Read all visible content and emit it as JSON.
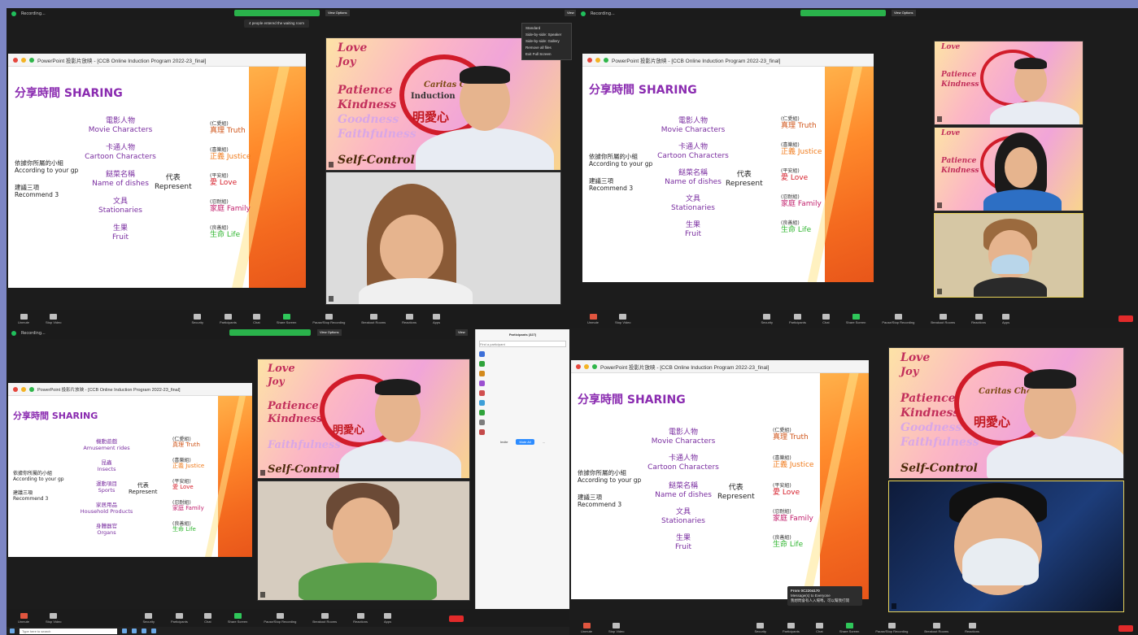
{
  "window": {
    "recording_label": "Recording...",
    "view_options": "View Options",
    "view": "View"
  },
  "slide": {
    "app_title": "PowerPoint 投影片放映 - [CCB Online Induction Program 2022-23_final]",
    "heading": "分享時間 SHARING",
    "group_label_zh": "依據你所屬的小組",
    "group_label_en": "According to your gp",
    "recommend_zh": "建議三項",
    "recommend_en": "Recommend 3",
    "represent_zh": "代表",
    "represent_en": "Represent",
    "categories_a": [
      {
        "zh": "電影人物",
        "en": "Movie Characters"
      },
      {
        "zh": "卡通人物",
        "en": "Cartoon Characters"
      },
      {
        "zh": "餸菜名稱",
        "en": "Name of dishes"
      },
      {
        "zh": "文具",
        "en": "Stationaries"
      },
      {
        "zh": "生果",
        "en": "Fruit"
      }
    ],
    "categories_b": [
      {
        "zh": "機動遊戲",
        "en": "Amusement rides"
      },
      {
        "zh": "昆蟲",
        "en": "Insects"
      },
      {
        "zh": "運動項目",
        "en": "Sports"
      },
      {
        "zh": "家居用品",
        "en": "Household Products"
      },
      {
        "zh": "身體器官",
        "en": "Organs"
      }
    ],
    "values": [
      {
        "tag": "(仁愛組)",
        "zh": "真理",
        "en": "Truth",
        "color": "#d0571c"
      },
      {
        "tag": "(喜樂組)",
        "zh": "正義",
        "en": "Justice",
        "color": "#f07a1a"
      },
      {
        "tag": "(平安組)",
        "zh": "愛",
        "en": "Love",
        "color": "#d61e2a"
      },
      {
        "tag": "(忍耐組)",
        "zh": "家庭",
        "en": "Family",
        "color": "#c2226e"
      },
      {
        "tag": "(良善組)",
        "zh": "生命",
        "en": "Life",
        "color": "#2fb52f"
      }
    ]
  },
  "poster": {
    "words": [
      "Love",
      "Joy",
      "Patience",
      "Kindness",
      "Goodness",
      "Faithfulness",
      "Self-Control"
    ],
    "logo": "Caritas Cha",
    "induction": "Induction",
    "motto_zh": "明愛心"
  },
  "toolbar": {
    "unmute": "Unmute",
    "stop_video": "Stop Video",
    "security": "Security",
    "participants": "Participants",
    "chat": "Chat",
    "share_screen": "Share Screen",
    "pause_recording": "Pause/Stop Recording",
    "breakout": "Breakout Rooms",
    "reactions": "Reactions",
    "apps": "Apps",
    "end": "End"
  },
  "view_menu": {
    "items": [
      "Standard",
      "Side-by-side: Speaker",
      "Side-by-side: Gallery",
      "Remove all files",
      "Exit Full Screen"
    ]
  },
  "notices": {
    "waiting": "4 people entered the waiting room"
  },
  "participants_panel": {
    "title": "Participants (327)",
    "search": "Find a participant",
    "mute_all": "Mute All",
    "buttons": [
      "Invite",
      "Mute All",
      "..."
    ]
  },
  "chat_popup": {
    "from": "From 0C2204170",
    "to": "Message(s) to Everyone",
    "body": "我想問會有人入場嗎，可以幫我打開"
  },
  "taskbar": {
    "search": "Type here to search"
  }
}
